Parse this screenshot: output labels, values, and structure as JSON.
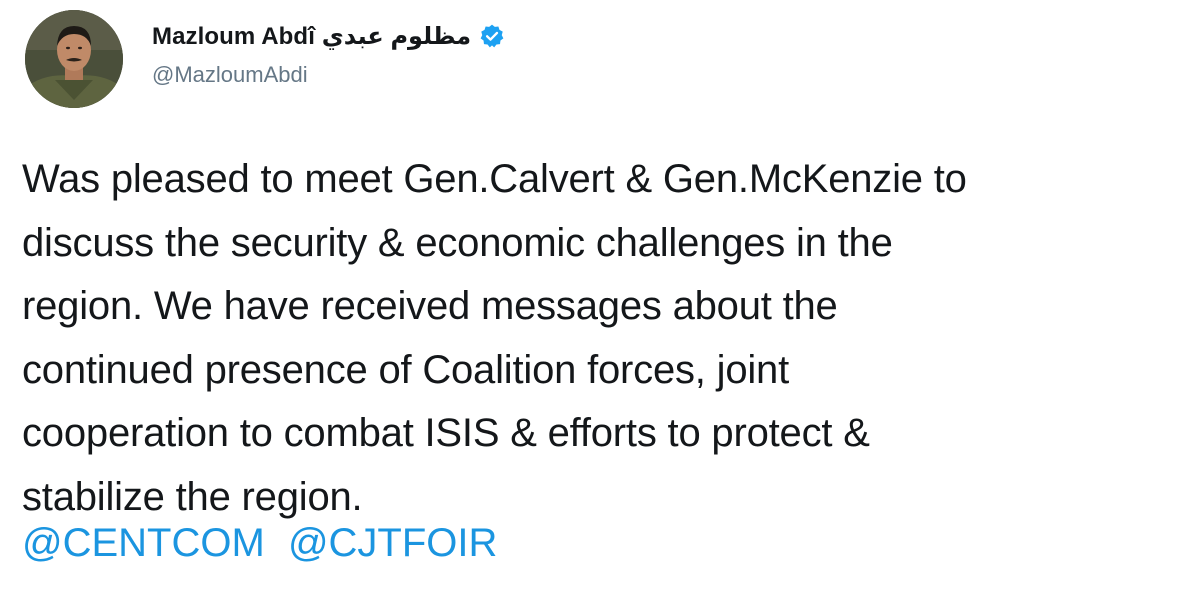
{
  "author": {
    "display_name": "Mazloum Abdî مظلوم عبدي",
    "handle": "@MazloumAbdi",
    "verified_icon": "verified-badge-icon",
    "avatar_icon": "profile-photo"
  },
  "tweet": {
    "lines": [
      "Was pleased to meet Gen.Calvert & Gen.McKenzie to",
      "discuss the security & economic challenges in the",
      "region. We have received messages about the",
      "continued presence of Coalition forces, joint",
      "cooperation to combat ISIS & efforts to protect &",
      "stabilize the region."
    ],
    "mentions": [
      "@CENTCOM",
      "@CJTFOIR"
    ]
  },
  "colors": {
    "text": "#14171a",
    "handle": "#657786",
    "link": "#1b95e0",
    "verified": "#1da1f2"
  }
}
